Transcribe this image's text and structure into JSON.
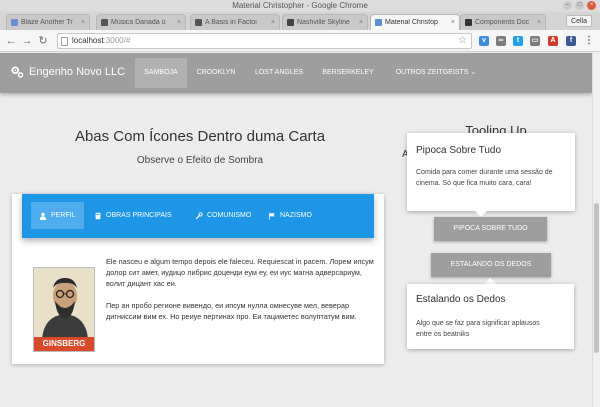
{
  "window": {
    "title": "Material Christopher - Google Chrome",
    "user": "Cella"
  },
  "tabs": [
    {
      "label": "Blaze Another Tr",
      "favicon_color": "#6a8fd8"
    },
    {
      "label": "Música Danada ú",
      "favicon_color": "#555555"
    },
    {
      "label": "A Basis in Factoi",
      "favicon_color": "#555555"
    },
    {
      "label": "Nashville Skyline",
      "favicon_color": "#444444"
    },
    {
      "label": "Material Christop",
      "favicon_color": "#5b8fd6"
    },
    {
      "label": "Components Doc",
      "favicon_color": "#333333"
    }
  ],
  "address_bar": {
    "host": "localhost",
    "path": ":3000/#"
  },
  "extensions": [
    {
      "name": "v-icon",
      "color": "#3a8fe0",
      "glyph": "v"
    },
    {
      "name": "pocket-icon",
      "color": "#7c7c7c",
      "glyph": "∞"
    },
    {
      "name": "twitter-icon",
      "color": "#1da1f2",
      "glyph": "t"
    },
    {
      "name": "cast-icon",
      "color": "#7c7c7c",
      "glyph": "▭"
    },
    {
      "name": "type-icon",
      "color": "#d03a2a",
      "glyph": "A"
    },
    {
      "name": "facebook-icon",
      "color": "#3b5998",
      "glyph": "f"
    },
    {
      "name": "menu-icon",
      "color": "#f6f6f6",
      "glyph": "⋮"
    }
  ],
  "appbar": {
    "brand": "Engenho Novo LLC",
    "nav": [
      "SAMBOJA",
      "CROOKLYN",
      "LOST ANGLES",
      "BERSERKELEY",
      "OUTROS ZEITGEISTS"
    ],
    "active_index": 0
  },
  "main": {
    "title": "Abas Com Ícones Dentro duma Carta",
    "subtitle": "Observe o Efeito de Sombra",
    "card": {
      "tabs": [
        {
          "label": "PERFIL",
          "icon": "person-icon"
        },
        {
          "label": "OBRAS PRINCIPAIS",
          "icon": "book-icon"
        },
        {
          "label": "COMUNISMO",
          "icon": "wrench-icon"
        },
        {
          "label": "NAZISMO",
          "icon": "flag-icon"
        }
      ],
      "active_tab": 0,
      "photo_caption": "GINSBERG",
      "paragraph_1": "Ele nasceu e algum tempo depois ele faleceu. Requiescat in pacem. Лорем ипсум долор сит амет, иудицо либрис доценди еум еу, еи иус магна адверсариум, волит дицант хас еи.",
      "paragraph_2": "Пер ан пробо регионе вивендо, еи ипсум нулла омнесуве мел, веверар дигниссим вим ех. Но реиуе пертинах про. Еи тациметес волуптатум вим."
    },
    "accent_color": "#1e96e8"
  },
  "tooling": {
    "title": "Tooling Up",
    "partial_text": "A",
    "popover_1": {
      "title": "Pipoca Sobre Tudo",
      "body": "Comida para comer durante uma sessão de cinema. Só que fica muito cara, cara!"
    },
    "button_1": "PIPOCA SOBRE TUDO",
    "button_2": "ESTALANDO OS DEDOS",
    "popover_2": {
      "title": "Estalando os Dedos",
      "body": "Algo que se faz para significar aplausos entre os beatniks"
    }
  }
}
